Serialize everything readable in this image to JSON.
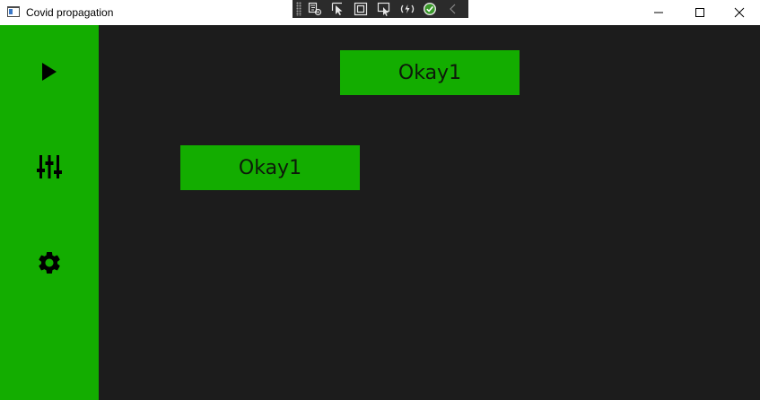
{
  "window": {
    "title": "Covid propagation",
    "app_icon": "window-app-icon"
  },
  "debug_toolbar": {
    "buttons": [
      {
        "icon": "live-visual-tree-icon"
      },
      {
        "icon": "select-element-icon"
      },
      {
        "icon": "display-layout-adorners-icon"
      },
      {
        "icon": "track-focused-element-icon"
      },
      {
        "icon": "hot-reload-icon"
      },
      {
        "icon": "xaml-hot-reload-status-icon"
      },
      {
        "icon": "collapse-toolbar-icon"
      }
    ]
  },
  "caption_buttons": {
    "minimize": "minimize-icon",
    "maximize": "maximize-icon",
    "close": "close-icon"
  },
  "sidebar": {
    "items": [
      {
        "name": "play",
        "icon": "play-icon"
      },
      {
        "name": "adjust",
        "icon": "sliders-icon"
      },
      {
        "name": "settings",
        "icon": "gear-icon"
      }
    ]
  },
  "main": {
    "buttons": [
      {
        "label": "Okay1"
      },
      {
        "label": "Okay1"
      }
    ]
  },
  "colors": {
    "accent_green": "#13ad00",
    "content_background": "#1c1c1c",
    "titlebar_background": "#ffffff",
    "debug_toolbar_background": "#2b2b2b"
  }
}
